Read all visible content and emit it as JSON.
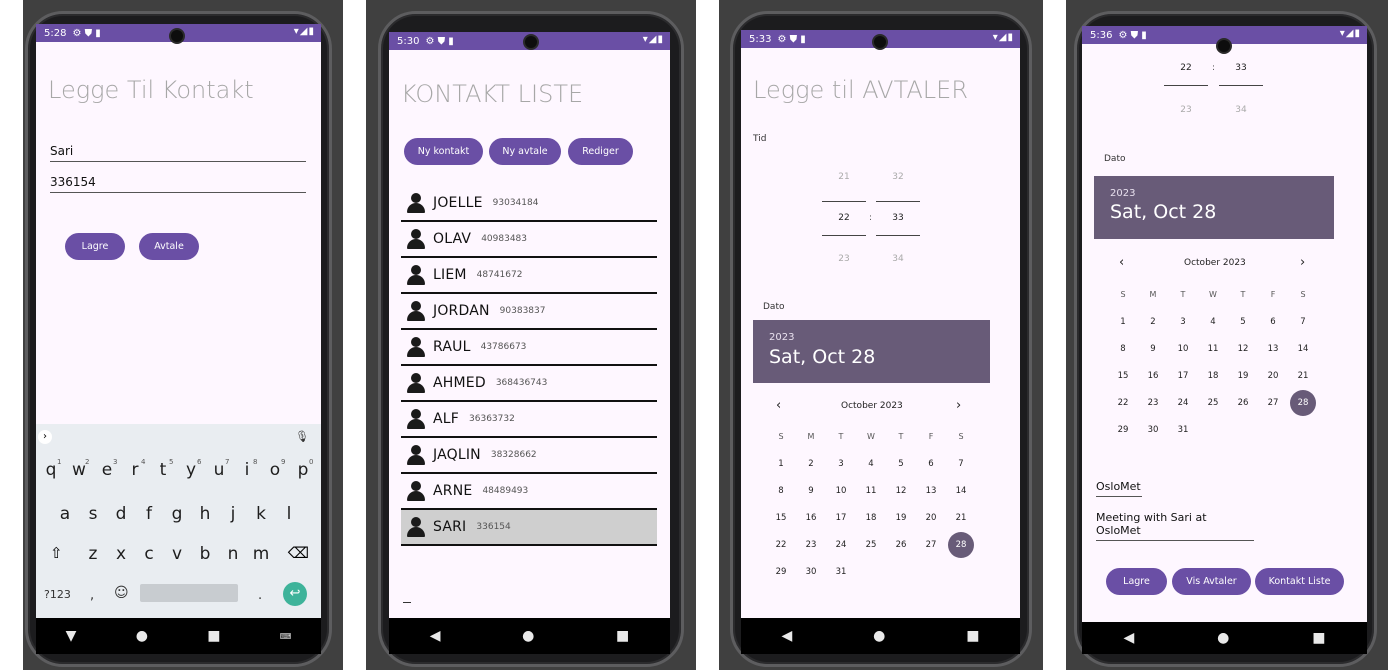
{
  "status": {
    "p1_time": "5:28",
    "p2_time": "5:30",
    "p3_time": "5:33",
    "p4_time": "5:36",
    "icons": "⚙ ⛊ ▮"
  },
  "screen1": {
    "title": "Legge Til Kontakt",
    "name_value": "Sari",
    "phone_value": "336154",
    "save_label": "Lagre",
    "appointment_label": "Avtale",
    "keyboard": {
      "row1": [
        "q",
        "w",
        "e",
        "r",
        "t",
        "y",
        "u",
        "i",
        "o",
        "p"
      ],
      "row1_hints": [
        "1",
        "2",
        "3",
        "4",
        "5",
        "6",
        "7",
        "8",
        "9",
        "0"
      ],
      "row2": [
        "a",
        "s",
        "d",
        "f",
        "g",
        "h",
        "j",
        "k",
        "l"
      ],
      "row3": [
        "z",
        "x",
        "c",
        "v",
        "b",
        "n",
        "m"
      ],
      "numbers_key": "?123",
      "comma": ",",
      "period": "."
    }
  },
  "screen2": {
    "title": "KONTAKT LISTE",
    "buttons": [
      "Ny kontakt",
      "Ny avtale",
      "Rediger"
    ],
    "contacts": [
      {
        "name": "JOELLE",
        "phone": "93034184"
      },
      {
        "name": "OLAV",
        "phone": "40983483"
      },
      {
        "name": "LIEM",
        "phone": "48741672"
      },
      {
        "name": "JORDAN",
        "phone": "90383837"
      },
      {
        "name": "RAUL",
        "phone": "43786673"
      },
      {
        "name": "AHMED",
        "phone": "368436743"
      },
      {
        "name": "ALF",
        "phone": "36363732"
      },
      {
        "name": "JAQLIN",
        "phone": "38328662"
      },
      {
        "name": "ARNE",
        "phone": "48489493"
      },
      {
        "name": "SARI",
        "phone": "336154"
      }
    ],
    "selected_index": 9
  },
  "screen3": {
    "title": "Legge til AVTALER",
    "time_label": "Tid",
    "hours": [
      "21",
      "22",
      "23"
    ],
    "minutes": [
      "32",
      "33",
      "34"
    ],
    "colon": ":",
    "date_label": "Dato",
    "year": "2023",
    "date_heading": "Sat, Oct 28",
    "month_label": "October 2023",
    "weekdays": [
      "S",
      "M",
      "T",
      "W",
      "T",
      "F",
      "S"
    ],
    "days": [
      [
        "1",
        "2",
        "3",
        "4",
        "5",
        "6",
        "7"
      ],
      [
        "8",
        "9",
        "10",
        "11",
        "12",
        "13",
        "14"
      ],
      [
        "15",
        "16",
        "17",
        "18",
        "19",
        "20",
        "21"
      ],
      [
        "22",
        "23",
        "24",
        "25",
        "26",
        "27",
        "28"
      ],
      [
        "29",
        "30",
        "31"
      ]
    ],
    "selected_day": "28"
  },
  "screen4": {
    "hours": [
      "22",
      "23"
    ],
    "minutes": [
      "33",
      "34"
    ],
    "colon": ":",
    "date_label": "Dato",
    "year": "2023",
    "date_heading": "Sat, Oct 28",
    "month_label": "October 2023",
    "weekdays": [
      "S",
      "M",
      "T",
      "W",
      "T",
      "F",
      "S"
    ],
    "days": [
      [
        "1",
        "2",
        "3",
        "4",
        "5",
        "6",
        "7"
      ],
      [
        "8",
        "9",
        "10",
        "11",
        "12",
        "13",
        "14"
      ],
      [
        "15",
        "16",
        "17",
        "18",
        "19",
        "20",
        "21"
      ],
      [
        "22",
        "23",
        "24",
        "25",
        "26",
        "27",
        "28"
      ],
      [
        "29",
        "30",
        "31"
      ]
    ],
    "selected_day": "28",
    "place_value": "OsloMet",
    "description_value": "Meeting with Sari at OsloMet",
    "buttons": [
      "Lagre",
      "Vis Avtaler",
      "Kontakt Liste"
    ]
  },
  "nav": {
    "back": "◀",
    "home": "●",
    "recents": "■"
  },
  "colors": {
    "accent": "#6a4fa5",
    "date_header": "#685b78",
    "screen_bg": "#fef7ff",
    "frame_bg": "#404040"
  }
}
